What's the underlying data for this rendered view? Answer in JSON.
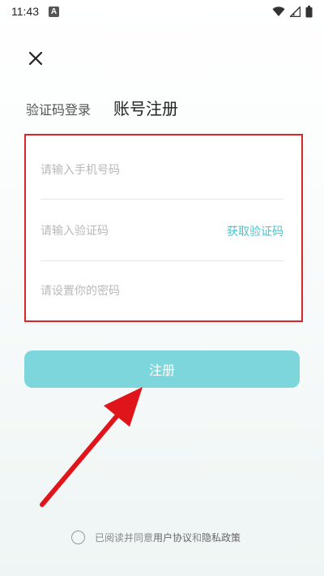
{
  "status_bar": {
    "time": "11:43",
    "notification_icon_letter": "A",
    "icons": [
      "wifi-icon",
      "signal-icon",
      "battery-icon"
    ]
  },
  "header": {
    "close_icon": "close-icon"
  },
  "tabs": [
    {
      "label": "验证码登录",
      "active": false
    },
    {
      "label": "账号注册",
      "active": true
    }
  ],
  "form": {
    "phone_placeholder": "请输入手机号码",
    "code_placeholder": "请输入验证码",
    "get_code_label": "获取验证码",
    "password_placeholder": "请设置你的密码"
  },
  "register_button_label": "注册",
  "agreement": {
    "prefix": "已阅读并同意",
    "user_agreement": "用户协议",
    "conjunction": "和",
    "privacy_policy": "隐私政策"
  },
  "colors": {
    "accent": "#4fc3cc",
    "button": "#7dd6dc",
    "annotation": "#d8262b"
  }
}
